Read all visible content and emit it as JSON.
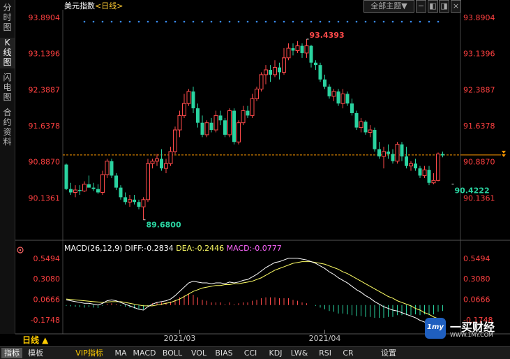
{
  "left_tabs": [
    {
      "label": "分时图",
      "active": false
    },
    {
      "label": "K线图",
      "active": true
    },
    {
      "label": "闪电图",
      "active": false
    },
    {
      "label": "合约资料",
      "active": false
    }
  ],
  "header": {
    "title": "美元指数",
    "period_tag": "<日线>",
    "theme_button": "全部主题▼"
  },
  "period_indicator": "日线 ▲",
  "bottom_tabs": [
    "指标",
    "模板",
    "VIP指标",
    "MA",
    "MACD",
    "BOLL",
    "VOL",
    "BIAS",
    "CCI",
    "KDJ",
    "LW&",
    "RSI",
    "CR",
    "",
    "设置"
  ],
  "watermark": {
    "text": "一买财经",
    "url": "WWW.1MY.COM",
    "logo": "1my"
  },
  "colors": {
    "up": "#ff4a4a",
    "down": "#2ad3a0",
    "diff": "#ffffff",
    "dea": "#ffff66",
    "macd": "#ff66ff",
    "axis_label": "#ff4040",
    "dots": "#3a8cff",
    "ref_line": "#ff9900"
  },
  "chart_data": [
    {
      "type": "candlestick",
      "title": "美元指数 <日线>",
      "y_ticks": [
        "93.8904",
        "93.1396",
        "92.3887",
        "91.6378",
        "90.8870",
        "90.1361"
      ],
      "ylim": [
        89.4,
        94.05
      ],
      "x_ticks": [
        {
          "index": 25,
          "label": "2021/03"
        },
        {
          "index": 57,
          "label": "2021/04"
        }
      ],
      "high_label": {
        "index": 53,
        "value": "93.4393"
      },
      "low_label": {
        "index": 17,
        "value": "89.6800"
      },
      "last_label": {
        "index": 85,
        "value": "90.4222"
      },
      "reference_price": 91.03,
      "candles": [
        [
          90.83,
          90.85,
          90.3,
          90.32
        ],
        [
          90.32,
          90.45,
          90.2,
          90.25
        ],
        [
          90.25,
          90.4,
          90.15,
          90.3
        ],
        [
          90.3,
          90.4,
          90.2,
          90.28
        ],
        [
          90.28,
          90.48,
          90.26,
          90.42
        ],
        [
          90.42,
          90.6,
          90.38,
          90.35
        ],
        [
          90.35,
          90.45,
          90.28,
          90.32
        ],
        [
          90.32,
          90.42,
          90.22,
          90.25
        ],
        [
          90.25,
          90.7,
          90.2,
          90.62
        ],
        [
          90.62,
          90.95,
          90.55,
          90.9
        ],
        [
          90.9,
          90.95,
          90.55,
          90.6
        ],
        [
          90.6,
          90.65,
          90.3,
          90.35
        ],
        [
          90.35,
          90.4,
          90.1,
          90.15
        ],
        [
          90.15,
          90.25,
          90.0,
          90.05
        ],
        [
          90.05,
          90.2,
          89.95,
          90.1
        ],
        [
          90.1,
          90.2,
          90.0,
          90.05
        ],
        [
          90.05,
          90.1,
          89.9,
          89.95
        ],
        [
          89.95,
          90.15,
          89.68,
          90.1
        ],
        [
          90.1,
          90.95,
          90.05,
          90.85
        ],
        [
          90.85,
          90.95,
          90.75,
          90.9
        ],
        [
          90.9,
          91.05,
          90.8,
          90.95
        ],
        [
          90.95,
          91.15,
          90.7,
          90.75
        ],
        [
          90.75,
          90.95,
          90.65,
          90.85
        ],
        [
          90.85,
          91.2,
          90.8,
          91.1
        ],
        [
          91.1,
          91.62,
          91.05,
          91.55
        ],
        [
          91.55,
          91.95,
          91.4,
          91.85
        ],
        [
          91.85,
          92.3,
          91.8,
          92.1
        ],
        [
          92.1,
          92.4,
          92.05,
          92.35
        ],
        [
          92.35,
          92.45,
          91.9,
          92.0
        ],
        [
          92.0,
          92.1,
          91.6,
          91.7
        ],
        [
          91.7,
          91.85,
          91.4,
          91.45
        ],
        [
          91.45,
          91.75,
          91.4,
          91.7
        ],
        [
          91.7,
          91.8,
          91.5,
          91.55
        ],
        [
          91.55,
          91.95,
          91.5,
          91.85
        ],
        [
          91.85,
          91.95,
          91.65,
          91.75
        ],
        [
          91.75,
          91.8,
          91.4,
          91.45
        ],
        [
          91.45,
          92.0,
          91.4,
          91.95
        ],
        [
          91.95,
          92.0,
          91.25,
          91.3
        ],
        [
          91.3,
          91.75,
          91.25,
          91.7
        ],
        [
          91.7,
          92.05,
          91.65,
          91.95
        ],
        [
          91.95,
          92.05,
          91.8,
          91.85
        ],
        [
          91.85,
          92.3,
          91.8,
          92.2
        ],
        [
          92.2,
          92.45,
          92.15,
          92.4
        ],
        [
          92.4,
          92.75,
          92.35,
          92.7
        ],
        [
          92.7,
          92.9,
          92.5,
          92.8
        ],
        [
          92.8,
          92.9,
          92.55,
          92.7
        ],
        [
          92.7,
          93.0,
          92.65,
          92.85
        ],
        [
          92.85,
          92.95,
          92.6,
          92.75
        ],
        [
          92.75,
          93.25,
          92.7,
          93.05
        ],
        [
          93.05,
          93.35,
          93.0,
          93.25
        ],
        [
          93.25,
          93.35,
          93.1,
          93.2
        ],
        [
          93.2,
          93.4,
          93.15,
          93.3
        ],
        [
          93.3,
          93.35,
          93.05,
          93.15
        ],
        [
          93.15,
          93.44,
          93.05,
          93.3
        ],
        [
          93.3,
          93.32,
          92.85,
          92.95
        ],
        [
          92.95,
          93.0,
          92.8,
          92.9
        ],
        [
          92.9,
          92.95,
          92.55,
          92.6
        ],
        [
          92.6,
          92.7,
          92.4,
          92.45
        ],
        [
          92.45,
          92.5,
          92.2,
          92.25
        ],
        [
          92.25,
          92.4,
          92.15,
          92.35
        ],
        [
          92.35,
          92.4,
          92.05,
          92.1
        ],
        [
          92.1,
          92.4,
          92.0,
          92.3
        ],
        [
          92.3,
          92.35,
          92.05,
          92.1
        ],
        [
          92.1,
          92.2,
          91.85,
          91.9
        ],
        [
          91.9,
          91.95,
          91.55,
          91.6
        ],
        [
          91.6,
          91.8,
          91.5,
          91.72
        ],
        [
          91.72,
          91.75,
          91.45,
          91.5
        ],
        [
          91.5,
          91.65,
          91.4,
          91.55
        ],
        [
          91.55,
          91.6,
          91.1,
          91.15
        ],
        [
          91.15,
          91.3,
          90.95,
          91.0
        ],
        [
          91.0,
          91.2,
          90.75,
          91.1
        ],
        [
          91.1,
          91.25,
          90.95,
          91.05
        ],
        [
          91.05,
          91.15,
          90.85,
          90.9
        ],
        [
          90.9,
          91.3,
          90.85,
          91.25
        ],
        [
          91.25,
          91.3,
          90.9,
          91.0
        ],
        [
          91.0,
          91.2,
          90.75,
          90.8
        ],
        [
          90.8,
          90.9,
          90.7,
          90.85
        ],
        [
          90.85,
          90.95,
          90.7,
          90.75
        ],
        [
          90.75,
          90.8,
          90.55,
          90.6
        ],
        [
          90.6,
          90.8,
          90.55,
          90.72
        ],
        [
          90.72,
          90.8,
          90.4,
          90.45
        ],
        [
          90.45,
          90.65,
          90.42,
          90.5
        ],
        [
          90.5,
          91.08,
          90.48,
          91.05
        ],
        [
          91.05,
          91.1,
          90.98,
          91.02
        ]
      ]
    },
    {
      "type": "macd",
      "params": "MACD(26,12,9)",
      "diff_text": "DIFF:-0.2834",
      "dea_text": "DEA:-0.2446",
      "macd_text": "MACD:-0.0777",
      "y_ticks": [
        "0.5494",
        "0.3080",
        "0.0666",
        "-0.1748"
      ],
      "ylim": [
        -0.29,
        0.63
      ],
      "diff": [
        0.06,
        0.05,
        0.04,
        0.03,
        0.02,
        0.02,
        0.01,
        0.0,
        0.02,
        0.05,
        0.06,
        0.05,
        0.03,
        0.01,
        -0.01,
        -0.03,
        -0.05,
        -0.06,
        -0.02,
        0.01,
        0.03,
        0.04,
        0.05,
        0.07,
        0.11,
        0.16,
        0.21,
        0.26,
        0.28,
        0.27,
        0.26,
        0.26,
        0.25,
        0.26,
        0.26,
        0.25,
        0.27,
        0.26,
        0.27,
        0.29,
        0.3,
        0.33,
        0.36,
        0.4,
        0.44,
        0.47,
        0.5,
        0.51,
        0.53,
        0.55,
        0.55,
        0.55,
        0.54,
        0.53,
        0.51,
        0.49,
        0.46,
        0.43,
        0.39,
        0.36,
        0.32,
        0.29,
        0.26,
        0.22,
        0.18,
        0.15,
        0.11,
        0.08,
        0.04,
        0.01,
        -0.02,
        -0.04,
        -0.06,
        -0.07,
        -0.09,
        -0.11,
        -0.13,
        -0.15,
        -0.18,
        -0.2,
        -0.23,
        -0.25,
        -0.24,
        -0.25
      ],
      "dea": [
        0.07,
        0.065,
        0.06,
        0.055,
        0.05,
        0.045,
        0.04,
        0.035,
        0.03,
        0.035,
        0.04,
        0.04,
        0.04,
        0.03,
        0.02,
        0.01,
        0.0,
        -0.01,
        -0.01,
        -0.01,
        0.0,
        0.01,
        0.02,
        0.03,
        0.05,
        0.07,
        0.1,
        0.13,
        0.16,
        0.18,
        0.2,
        0.21,
        0.22,
        0.23,
        0.23,
        0.24,
        0.24,
        0.25,
        0.25,
        0.26,
        0.27,
        0.28,
        0.3,
        0.32,
        0.35,
        0.38,
        0.41,
        0.43,
        0.45,
        0.47,
        0.49,
        0.5,
        0.51,
        0.51,
        0.51,
        0.5,
        0.49,
        0.48,
        0.46,
        0.44,
        0.42,
        0.39,
        0.37,
        0.34,
        0.31,
        0.28,
        0.25,
        0.22,
        0.19,
        0.16,
        0.13,
        0.1,
        0.08,
        0.05,
        0.03,
        0.01,
        -0.01,
        -0.04,
        -0.06,
        -0.09,
        -0.11,
        -0.14,
        -0.16,
        -0.18
      ],
      "macd": [
        -0.01,
        -0.015,
        -0.02,
        -0.025,
        -0.03,
        -0.025,
        -0.03,
        -0.035,
        -0.01,
        0.015,
        0.02,
        0.01,
        -0.01,
        -0.02,
        -0.03,
        -0.04,
        -0.05,
        -0.05,
        -0.01,
        0.02,
        0.03,
        0.03,
        0.03,
        0.04,
        0.06,
        0.09,
        0.11,
        0.13,
        0.12,
        0.09,
        0.06,
        0.05,
        0.03,
        0.03,
        0.03,
        0.01,
        0.03,
        0.01,
        0.02,
        0.03,
        0.03,
        0.05,
        0.06,
        0.08,
        0.09,
        0.09,
        0.09,
        0.08,
        0.08,
        0.08,
        0.06,
        0.05,
        0.03,
        0.02,
        0.0,
        -0.01,
        -0.03,
        -0.05,
        -0.07,
        -0.08,
        -0.1,
        -0.1,
        -0.11,
        -0.12,
        -0.13,
        -0.13,
        -0.14,
        -0.14,
        -0.15,
        -0.15,
        -0.15,
        -0.14,
        -0.14,
        -0.12,
        -0.12,
        -0.12,
        -0.12,
        -0.11,
        -0.12,
        -0.11,
        -0.12,
        -0.11,
        -0.08,
        -0.07
      ]
    }
  ]
}
